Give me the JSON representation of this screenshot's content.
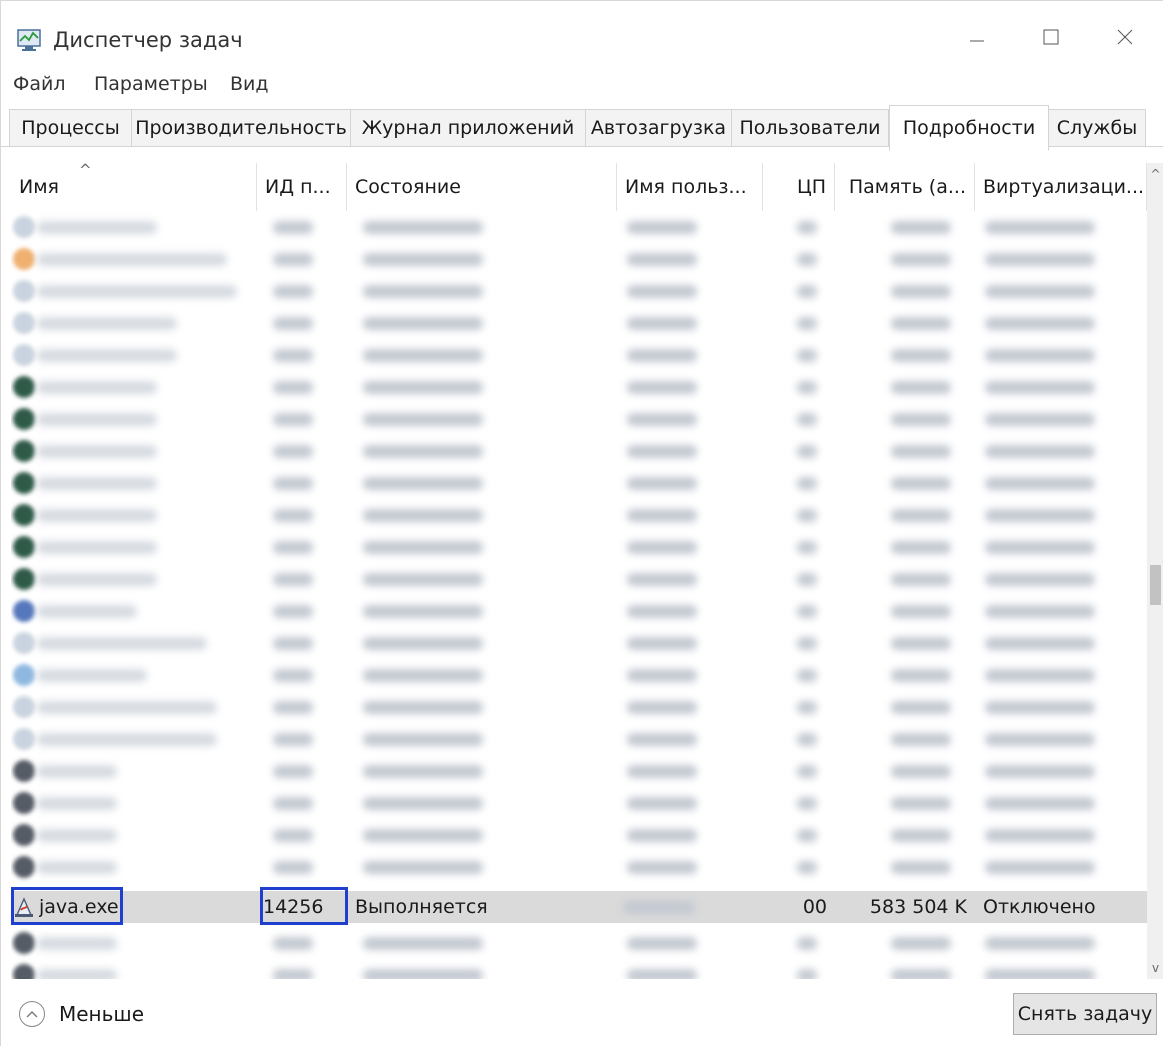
{
  "window": {
    "title": "Диспетчер задач",
    "icon": "task-manager-icon",
    "controls": [
      "minimize-icon",
      "maximize-icon",
      "close-icon"
    ]
  },
  "menu": [
    "Файл",
    "Параметры",
    "Вид"
  ],
  "tabs": [
    {
      "label": "Процессы",
      "active": false
    },
    {
      "label": "Производительность",
      "active": false
    },
    {
      "label": "Журнал приложений",
      "active": false
    },
    {
      "label": "Автозагрузка",
      "active": false
    },
    {
      "label": "Пользователи",
      "active": false
    },
    {
      "label": "Подробности",
      "active": true
    },
    {
      "label": "Службы",
      "active": false
    }
  ],
  "table": {
    "sorted_by": "Имя",
    "columns": [
      "Имя",
      "ИД п...",
      "Состояние",
      "Имя польз...",
      "ЦП",
      "Память (а...",
      "Виртуализаци..."
    ],
    "blurred_row_count": 21,
    "selected_row": {
      "name": "java.exe",
      "pid": "14256",
      "status": "Выполняется",
      "user": "",
      "cpu": "00",
      "memory": "583 504 K",
      "virtualization": "Отключено",
      "icon": "java-icon"
    },
    "trailing_blurred_row_count": 2
  },
  "footer": {
    "less_label": "Меньше",
    "end_task_label": "Снять задачу"
  },
  "colors": {
    "highlight_box": "#1f3fcf",
    "selected_row": "#dadada",
    "tab_border": "#d4d4d4"
  }
}
